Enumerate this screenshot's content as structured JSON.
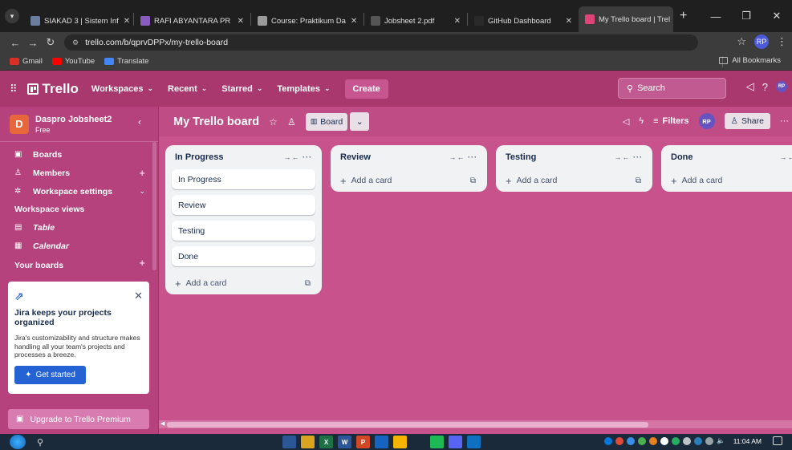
{
  "browser": {
    "tabs": [
      {
        "label": "SIAKAD 3 | Sistem Inf",
        "fav_color": "#6a7fa0",
        "active": false
      },
      {
        "label": "RAFI ABYANTARA PR",
        "fav_color": "#8a5cc0",
        "active": false
      },
      {
        "label": "Course: Praktikum Da",
        "fav_color": "#9a9a9a",
        "active": false
      },
      {
        "label": "Jobsheet 2.pdf",
        "fav_color": "#555555",
        "active": false
      },
      {
        "label": "GitHub Dashboard",
        "fav_color": "#2a2a2a",
        "active": false
      },
      {
        "label": "My Trello board | Trel",
        "fav_color": "#e0427a",
        "active": true
      }
    ],
    "url": "trello.com/b/qprvDPPx/my-trello-board",
    "bookmarks": [
      {
        "label": "Gmail",
        "color": "#d93025"
      },
      {
        "label": "YouTube",
        "color": "#ff0000"
      },
      {
        "label": "Translate",
        "color": "#4285f4"
      }
    ],
    "all_bookmarks": "All Bookmarks",
    "extension_label": "RP"
  },
  "header": {
    "logo": "Trello",
    "menus": [
      "Workspaces",
      "Recent",
      "Starred",
      "Templates"
    ],
    "create": "Create",
    "search_placeholder": "Search",
    "avatar": "RP"
  },
  "sidebar": {
    "workspace_initial": "D",
    "workspace_name": "Daspro Jobsheet2",
    "workspace_plan": "Free",
    "items": [
      {
        "label": "Boards"
      },
      {
        "label": "Members"
      },
      {
        "label": "Workspace settings"
      }
    ],
    "views_heading": "Workspace views",
    "views": [
      {
        "label": "Table"
      },
      {
        "label": "Calendar"
      }
    ],
    "your_boards": "Your boards",
    "jira": {
      "title": "Jira keeps your projects organized",
      "desc": "Jira's customizability and structure makes handling all your team's projects and processes a breeze.",
      "button": "Get started"
    },
    "upgrade": "Upgrade to Trello Premium"
  },
  "board": {
    "title": "My Trello board",
    "view": "Board",
    "filters": "Filters",
    "avatar": "RP",
    "share": "Share",
    "lists": [
      {
        "title": "In Progress",
        "cards": [
          "In Progress",
          "Review",
          "Testing",
          "Done"
        ],
        "add": "Add a card"
      },
      {
        "title": "Review",
        "cards": [],
        "add": "Add a card"
      },
      {
        "title": "Testing",
        "cards": [],
        "add": "Add a card"
      },
      {
        "title": "Done",
        "cards": [],
        "add": "Add a card"
      }
    ]
  },
  "taskbar": {
    "apps": [
      {
        "label": "",
        "color": "#2b5797"
      },
      {
        "label": "",
        "color": "#d9a520"
      },
      {
        "label": "X",
        "color": "#1e7145"
      },
      {
        "label": "W",
        "color": "#2b579a"
      },
      {
        "label": "P",
        "color": "#d24726"
      },
      {
        "label": "",
        "color": "#1565c0"
      },
      {
        "label": "",
        "color": "#f4b400"
      },
      {
        "label": "",
        "color": "#1b2a3a"
      },
      {
        "label": "",
        "color": "#1db954"
      },
      {
        "label": "",
        "color": "#5865f2"
      },
      {
        "label": "",
        "color": "#0e70c0"
      }
    ],
    "time": "11:04 AM"
  }
}
